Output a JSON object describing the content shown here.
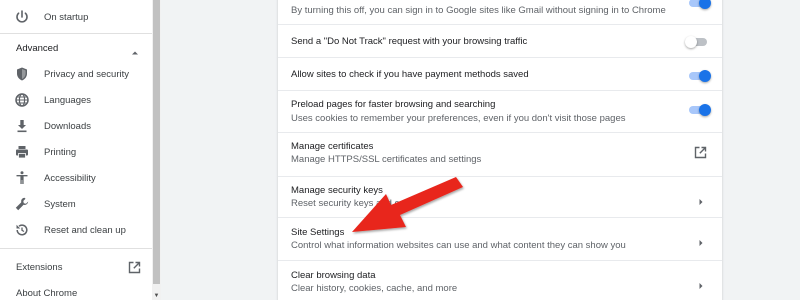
{
  "sidebar": {
    "on_startup": "On startup",
    "advanced": "Advanced",
    "items": [
      {
        "label": "Privacy and security",
        "icon": "shield-icon"
      },
      {
        "label": "Languages",
        "icon": "globe-icon"
      },
      {
        "label": "Downloads",
        "icon": "download-icon"
      },
      {
        "label": "Printing",
        "icon": "printer-icon"
      },
      {
        "label": "Accessibility",
        "icon": "accessibility-icon"
      },
      {
        "label": "System",
        "icon": "wrench-icon"
      },
      {
        "label": "Reset and clean up",
        "icon": "reset-icon"
      }
    ],
    "extensions": "Extensions",
    "about": "About Chrome"
  },
  "settings": {
    "rows": [
      {
        "title": "",
        "sub": "By turning this off, you can sign in to Google sites like Gmail without signing in to Chrome",
        "control": "toggle-on"
      },
      {
        "title": "Send a \"Do Not Track\" request with your browsing traffic",
        "sub": "",
        "control": "toggle-off"
      },
      {
        "title": "Allow sites to check if you have payment methods saved",
        "sub": "",
        "control": "toggle-on"
      },
      {
        "title": "Preload pages for faster browsing and searching",
        "sub": "Uses cookies to remember your preferences, even if you don't visit those pages",
        "control": "toggle-on"
      },
      {
        "title": "Manage certificates",
        "sub": "Manage HTTPS/SSL certificates and settings",
        "control": "external-link"
      },
      {
        "title": "Manage security keys",
        "sub": "Reset security keys and c",
        "control": "chevron"
      },
      {
        "title": "Site Settings",
        "sub": "Control what information websites can use and what content they can show you",
        "control": "chevron"
      },
      {
        "title": "Clear browsing data",
        "sub": "Clear history, cookies, cache, and more",
        "control": "chevron"
      }
    ]
  },
  "colors": {
    "accent": "#1a73e8",
    "annotation_arrow": "#e8261c",
    "background": "#f1f3f4"
  }
}
